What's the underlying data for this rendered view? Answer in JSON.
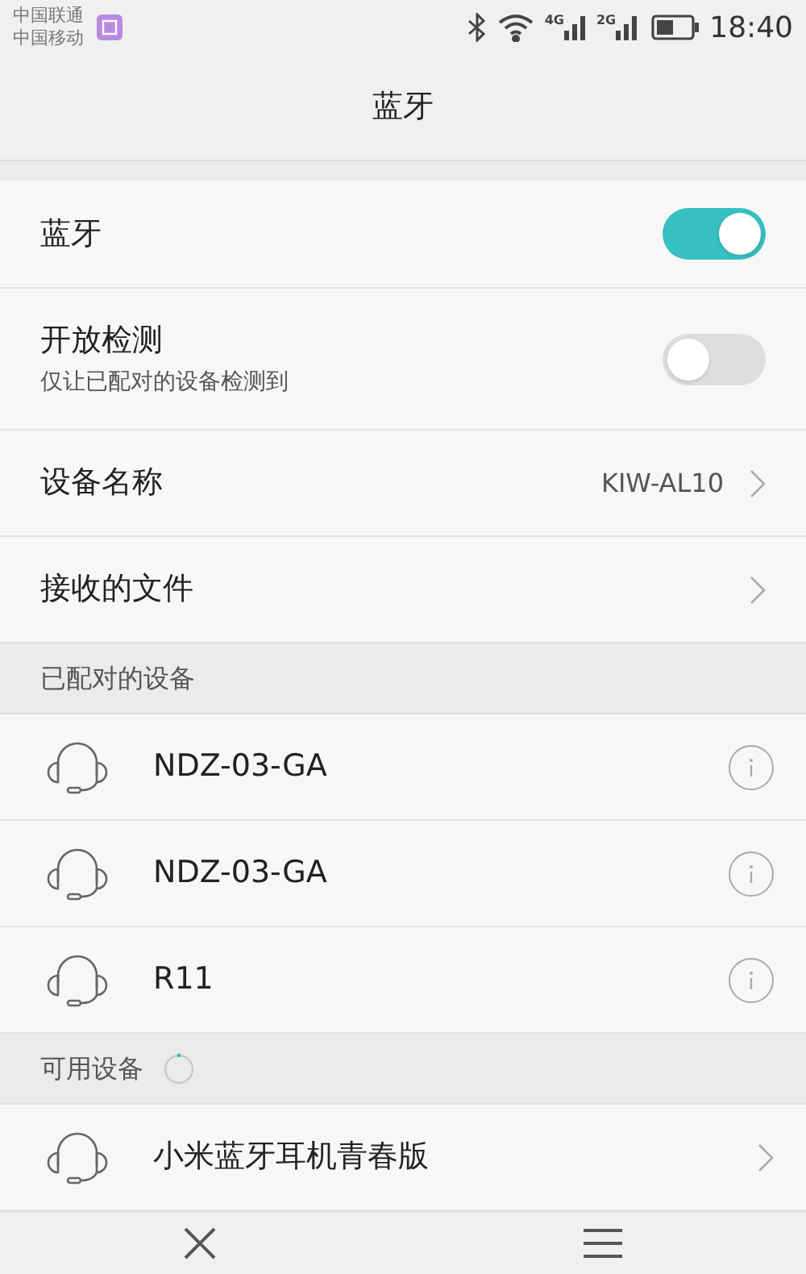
{
  "status_bar": {
    "carriers": [
      "中国联通",
      "中国移动"
    ],
    "time": "18:40",
    "network_labels": [
      "4G",
      "2G"
    ]
  },
  "title": "蓝牙",
  "settings": [
    {
      "kind": "toggle",
      "label": "蓝牙",
      "on": true
    },
    {
      "kind": "toggle",
      "label": "开放检测",
      "subtitle": "仅让已配对的设备检测到",
      "on": false
    },
    {
      "kind": "link",
      "label": "设备名称",
      "value": "KIW-AL10"
    },
    {
      "kind": "link",
      "label": "接收的文件"
    }
  ],
  "paired": {
    "header": "已配对的设备",
    "devices": [
      {
        "name": "NDZ-03-GA"
      },
      {
        "name": "NDZ-03-GA"
      },
      {
        "name": "R11"
      }
    ]
  },
  "available": {
    "header": "可用设备",
    "scanning": true,
    "devices": [
      {
        "name": "小米蓝牙耳机青春版"
      }
    ]
  }
}
